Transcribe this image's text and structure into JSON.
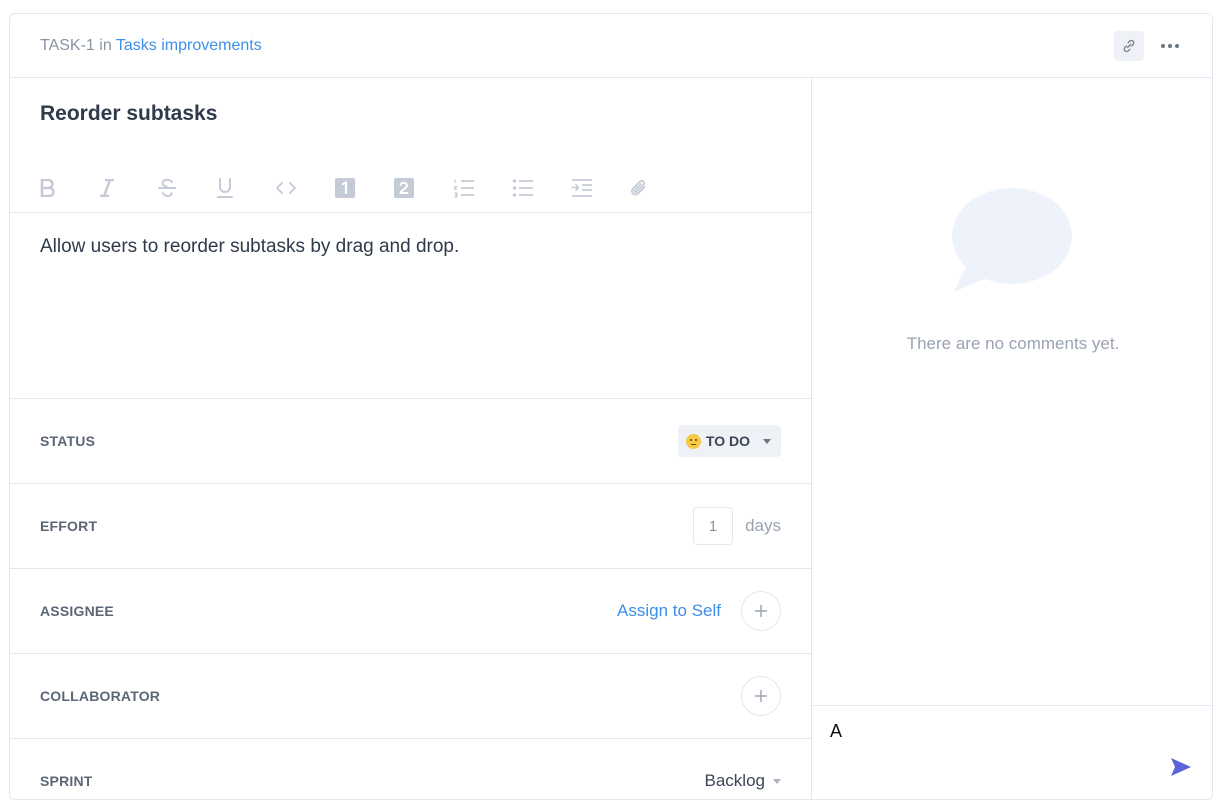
{
  "header": {
    "task_id": "TASK-1",
    "in_text": "in",
    "project": "Tasks improvements",
    "link_icon": "link-icon",
    "more_icon": "more-dots-icon"
  },
  "task": {
    "title": "Reorder subtasks",
    "description": "Allow users to reorder subtasks by drag and drop."
  },
  "toolbar": {
    "tools": [
      "bold",
      "italic",
      "strikethrough",
      "underline",
      "code",
      "heading-1",
      "heading-2",
      "ordered-list",
      "bullet-list",
      "indent",
      "attachment"
    ]
  },
  "fields": {
    "status": {
      "label": "STATUS",
      "value": "TO DO"
    },
    "effort": {
      "label": "EFFORT",
      "value": "1",
      "unit": "days"
    },
    "assignee": {
      "label": "ASSIGNEE",
      "action": "Assign to Self"
    },
    "collaborator": {
      "label": "COLLABORATOR"
    },
    "sprint": {
      "label": "SPRINT",
      "value": "Backlog"
    }
  },
  "comments": {
    "empty_text": "There are no comments yet.",
    "input_value": "A"
  },
  "colors": {
    "accent": "#3d8fe8",
    "send": "#5a63d8",
    "border": "#e3e7ef",
    "muted": "#9aa3b2"
  }
}
